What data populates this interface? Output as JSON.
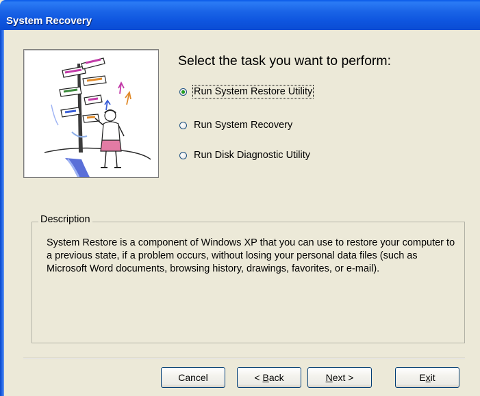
{
  "window": {
    "title": "System Recovery"
  },
  "main": {
    "heading": "Select the task you want to perform:",
    "options": [
      {
        "label": "Run System Restore Utility",
        "checked": true
      },
      {
        "label": "Run System Recovery",
        "checked": false
      },
      {
        "label": "Run Disk Diagnostic Utility",
        "checked": false
      }
    ]
  },
  "description": {
    "legend": "Description",
    "text": "System Restore is a component of Windows XP that you can use to restore your computer to a previous state, if a problem occurs, without losing your personal data files (such as Microsoft Word documents, browsing history, drawings, favorites, or e-mail)."
  },
  "buttons": {
    "cancel": "Cancel",
    "back_prefix": "< ",
    "back_access": "B",
    "back_rest": "ack",
    "next_access": "N",
    "next_rest": "ext >",
    "exit_pre": "E",
    "exit_access": "x",
    "exit_rest": "it"
  },
  "colors": {
    "titlebar": "#0A5AE8",
    "window_bg": "#ECE9D8",
    "radio_selected": "#21A121"
  },
  "icons": {
    "illustration": "crossroads-signpost-figure-illustration"
  }
}
